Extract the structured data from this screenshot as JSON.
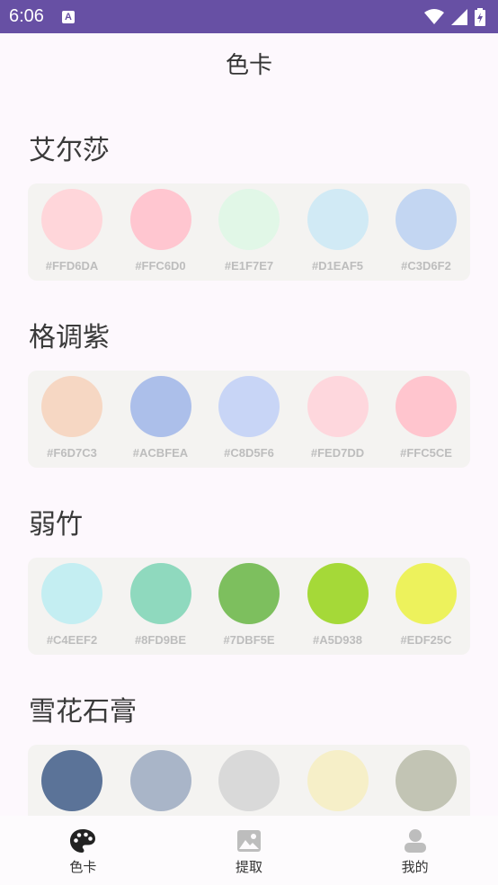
{
  "status_bar": {
    "time": "6:06",
    "notification_letter": "A"
  },
  "app_title": "色卡",
  "palettes": [
    {
      "name": "艾尔莎",
      "colors": [
        {
          "hex": "#FFD6DA",
          "label": "#FFD6DA"
        },
        {
          "hex": "#FFC6D0",
          "label": "#FFC6D0"
        },
        {
          "hex": "#E1F7E7",
          "label": "#E1F7E7"
        },
        {
          "hex": "#D1EAF5",
          "label": "#D1EAF5"
        },
        {
          "hex": "#C3D6F2",
          "label": "#C3D6F2"
        }
      ]
    },
    {
      "name": "格调紫",
      "colors": [
        {
          "hex": "#F6D7C3",
          "label": "#F6D7C3"
        },
        {
          "hex": "#ACBFEA",
          "label": "#ACBFEA"
        },
        {
          "hex": "#C8D5F6",
          "label": "#C8D5F6"
        },
        {
          "hex": "#FED7DD",
          "label": "#FED7DD"
        },
        {
          "hex": "#FFC5CE",
          "label": "#FFC5CE"
        }
      ]
    },
    {
      "name": "弱竹",
      "colors": [
        {
          "hex": "#C4EEF2",
          "label": "#C4EEF2"
        },
        {
          "hex": "#8FD9BE",
          "label": "#8FD9BE"
        },
        {
          "hex": "#7DBF5E",
          "label": "#7DBF5E"
        },
        {
          "hex": "#A5D938",
          "label": "#A5D938"
        },
        {
          "hex": "#EDF25C",
          "label": "#EDF25C"
        }
      ]
    },
    {
      "name": "雪花石膏",
      "colors": [
        {
          "hex": "#5B7398",
          "label": ""
        },
        {
          "hex": "#A9B5C8",
          "label": ""
        },
        {
          "hex": "#D9D9D9",
          "label": ""
        },
        {
          "hex": "#F6EFC8",
          "label": ""
        },
        {
          "hex": "#C2C4B4",
          "label": ""
        }
      ]
    }
  ],
  "bottom_nav": [
    {
      "label": "色卡",
      "icon": "palette-icon",
      "active": true
    },
    {
      "label": "提取",
      "icon": "image-icon",
      "active": false
    },
    {
      "label": "我的",
      "icon": "person-icon",
      "active": false
    }
  ]
}
